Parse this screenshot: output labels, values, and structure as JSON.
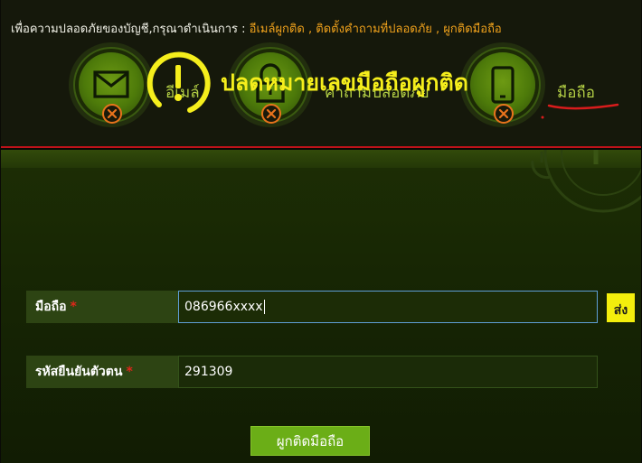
{
  "notice": {
    "prefix": "เพื่อความปลอดภัยของบัญชี,กรุณาดำเนินการ :",
    "link_email": "อีเมล์ผูกติด",
    "link_question": "ติดตั้งคำถามที่ปลอดภัย",
    "link_phone": "ผูกติดมือถือ",
    "separator": ","
  },
  "steps": [
    {
      "label": "อีเมล์",
      "icon": "envelope-icon",
      "status": "x-icon"
    },
    {
      "label": "คำถามปลอดภัย",
      "icon": "unlock-icon",
      "status": "x-icon"
    },
    {
      "label": "มือถือ",
      "icon": "mobile-phone-icon",
      "status": "x-icon"
    }
  ],
  "panel": {
    "title": "ปลดหมายเลขมือถือผูกติด",
    "icon": "exclamation-circle-icon"
  },
  "form": {
    "phone_label": "มือถือ",
    "phone_value": "086966xxxx",
    "code_label": "รหัสยืนยันตัวตน",
    "code_value": "291309",
    "required_mark": "*",
    "send_label": "ส่ง",
    "submit_label": "ผูกติดมือถือ"
  },
  "colors": {
    "accent_green": "#6bae17",
    "title_yellow": "#f5ee1c",
    "link_orange": "#f0a21c",
    "required_red": "#e0261a",
    "annotation_red": "#d81c1c"
  }
}
